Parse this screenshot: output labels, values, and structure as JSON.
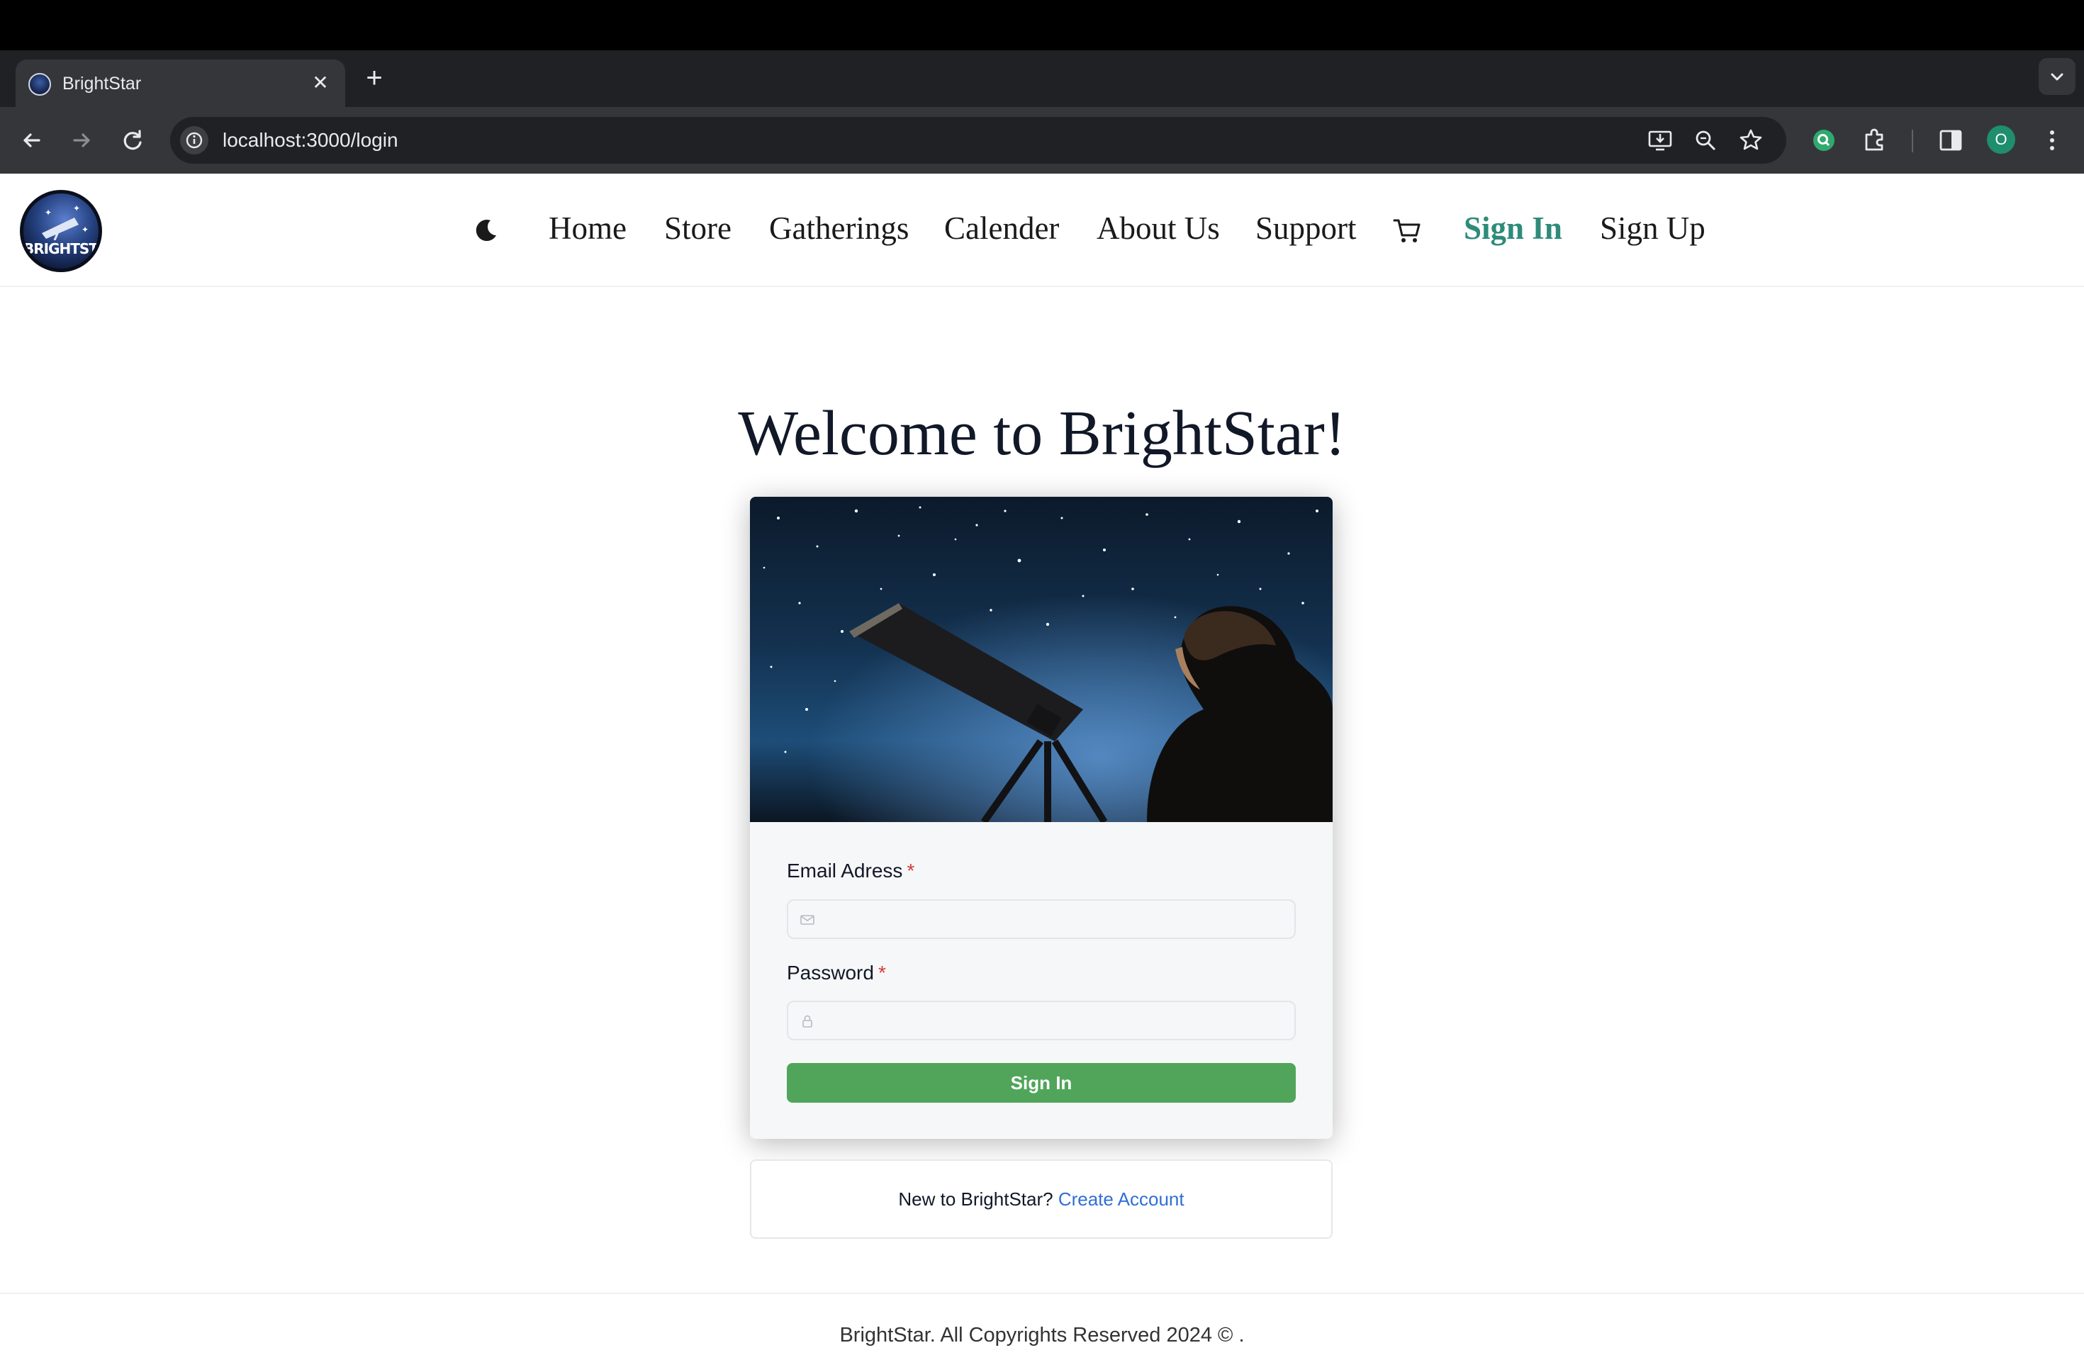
{
  "browser": {
    "tab_title": "BrightStar",
    "url": "localhost:3000/login",
    "profile_initial": "O"
  },
  "site": {
    "logo_text": "BRIGHTSTAR",
    "nav": {
      "theme_icon": "moon-icon",
      "items": [
        "Home",
        "Store",
        "Gatherings",
        "Calender",
        "About Us",
        "Support"
      ],
      "cart_icon": "cart-icon",
      "sign_in": "Sign In",
      "sign_up": "Sign Up"
    },
    "accent_color": "#2e8b7a"
  },
  "main": {
    "heading": "Welcome to BrightStar!",
    "form": {
      "email_label": "Email Adress",
      "password_label": "Password",
      "required_mark": "*",
      "email_value": "",
      "password_value": "",
      "submit_label": "Sign In",
      "button_color": "#50a55a"
    },
    "signup_prompt": {
      "text": "New to BrightStar?",
      "link": "Create Account"
    }
  },
  "footer": {
    "text": "BrightStar. All Copyrights Reserved 2024 © ."
  }
}
